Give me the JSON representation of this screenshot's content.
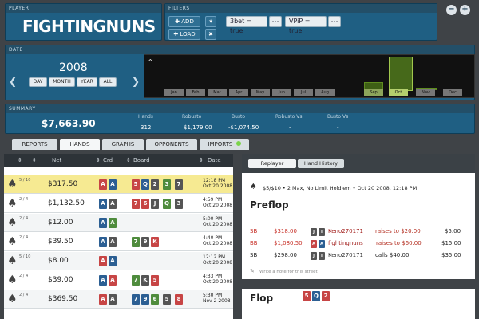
{
  "player": {
    "header": "PLAYER",
    "name": "FIGHTINGNUNS"
  },
  "filters": {
    "header": "FILTERS",
    "add_label": "ADD",
    "load_label": "LOAD",
    "chips": [
      "3bet = true",
      "VPiP = true"
    ],
    "more_label": "..."
  },
  "date": {
    "header": "DATE",
    "year": "2008",
    "buttons": [
      "DAY",
      "MONTH",
      "YEAR",
      "ALL"
    ],
    "months": [
      "Jan",
      "Feb",
      "Mar",
      "Apr",
      "May",
      "Jun",
      "Jul",
      "Aug",
      "Sep",
      "Oct",
      "Nov",
      "Dec"
    ]
  },
  "summary": {
    "header": "SUMMARY",
    "total": "$7,663.90",
    "columns": [
      {
        "label": "Hands",
        "value": "312"
      },
      {
        "label": "Robusto",
        "value": "$1,179.00"
      },
      {
        "label": "Busto",
        "value": "-$1,074.50"
      },
      {
        "label": "Robusto Vs",
        "value": "-"
      },
      {
        "label": "Busto Vs",
        "value": "-"
      }
    ]
  },
  "tabs": [
    "REPORTS",
    "HANDS",
    "GRAPHS",
    "OPPONENTS",
    "IMPORTS"
  ],
  "table": {
    "headers": [
      "Net",
      "Crd",
      "Board",
      "Date"
    ],
    "rows": [
      {
        "frac": "5 / 10",
        "net": "$317.50",
        "date1": "12:18 PM",
        "date2": "Oct 20 2008"
      },
      {
        "frac": "2 / 4",
        "net": "$1,132.50",
        "date1": "4:59 PM",
        "date2": "Oct 20 2008"
      },
      {
        "frac": "2 / 4",
        "net": "$12.00",
        "date1": "5:00 PM",
        "date2": "Oct 20 2008"
      },
      {
        "frac": "2 / 4",
        "net": "$39.50",
        "date1": "4:40 PM",
        "date2": "Oct 20 2008"
      },
      {
        "frac": "5 / 10",
        "net": "$8.00",
        "date1": "12:12 PM",
        "date2": "Oct 20 2008"
      },
      {
        "frac": "2 / 4",
        "net": "$39.00",
        "date1": "4:33 PM",
        "date2": "Oct 20 2008"
      },
      {
        "frac": "2 / 4",
        "net": "$369.50",
        "date1": "5:30 PM",
        "date2": "Nov 2 2008"
      }
    ]
  },
  "replayer": {
    "tabs": [
      "Replayer",
      "Hand History"
    ],
    "info": "$5/$10  •  2 Max, No Limit Hold'em  •  Oct 20 2008, 12:18 PM",
    "preflop": "Preflop",
    "actions": [
      {
        "pos": "SB",
        "amt": "$318.00",
        "player": "Keno270171",
        "text": "raises to $20.00",
        "right": "$5.00"
      },
      {
        "pos": "BB",
        "amt": "$1,080.50",
        "player": "fightingnuns",
        "text": "raises to $60.00",
        "right": "$15.00"
      },
      {
        "pos": "SB",
        "amt": "$298.00",
        "player": "Keno270171",
        "text": "calls $40.00",
        "right": "$35.00"
      }
    ],
    "note": "Write a note for this street",
    "flop": "Flop"
  }
}
